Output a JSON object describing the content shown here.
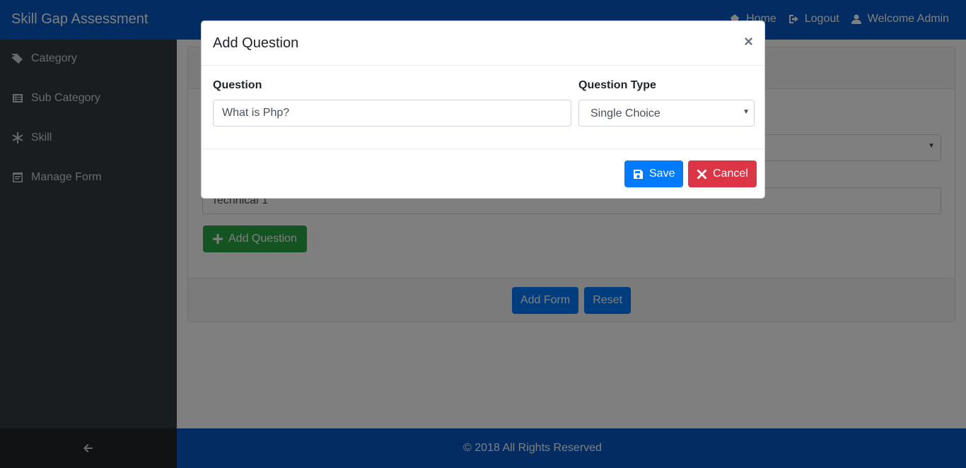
{
  "header": {
    "brand": "Skill Gap Assessment",
    "nav": {
      "home": "Home",
      "logout": "Logout",
      "welcome": "Welcome Admin"
    }
  },
  "sidebar": {
    "items": [
      {
        "label": "Category",
        "icon": "tags-icon"
      },
      {
        "label": "Sub Category",
        "icon": "list-icon"
      },
      {
        "label": "Skill",
        "icon": "asterisk-icon"
      },
      {
        "label": "Manage Form",
        "icon": "form-icon"
      }
    ],
    "collapse_icon": "arrow-left-icon"
  },
  "form": {
    "field_value": "Technical 1",
    "add_question_label": "Add Question",
    "add_form_label": "Add Form",
    "reset_label": "Reset"
  },
  "footer": {
    "copyright": "© 2018 All Rights Reserved"
  },
  "modal": {
    "title": "Add Question",
    "close": "×",
    "question_label": "Question",
    "question_value": "What is Php?",
    "question_type_label": "Question Type",
    "question_type_value": "Single Choice",
    "save_label": "Save",
    "cancel_label": "Cancel"
  },
  "colors": {
    "primary": "#007bff",
    "success": "#28a745",
    "danger": "#dc3545",
    "sidebar": "#343a40"
  }
}
